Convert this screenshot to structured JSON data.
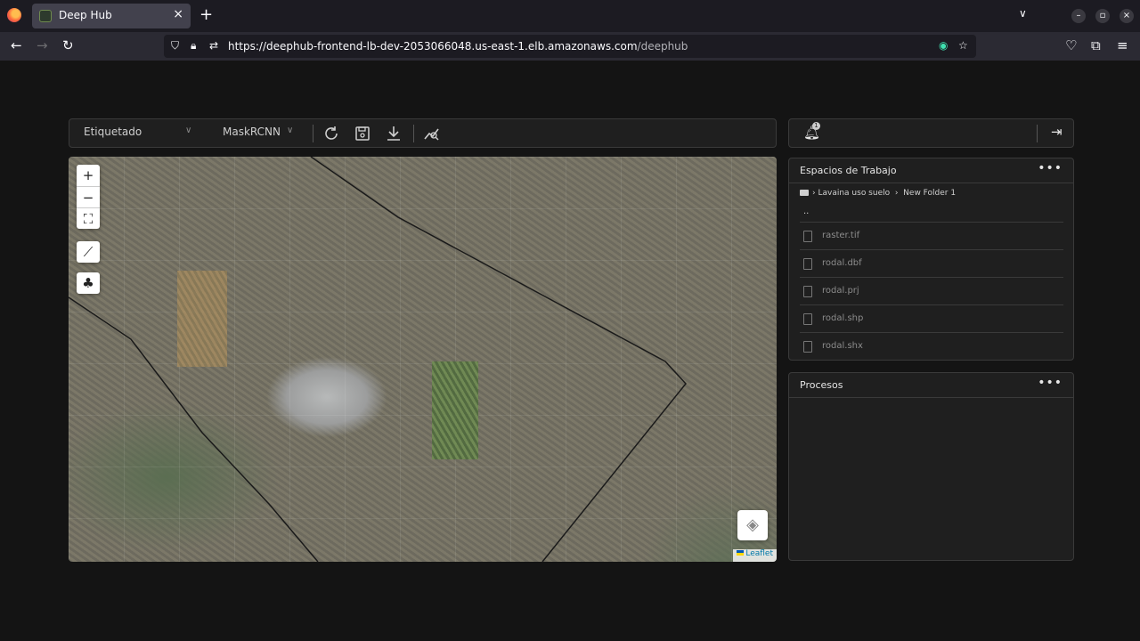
{
  "browser": {
    "tab_title": "Deep Hub",
    "tab_close": "×",
    "new_tab": "+",
    "url_host": "https://deephub-frontend-lb-dev-2053066048.us-east-1.elb.amazonaws.com",
    "url_path": "/deephub"
  },
  "toolbar": {
    "mode_select": "Etiquetado",
    "model_select": "MaskRCNN"
  },
  "map": {
    "zoom_in": "+",
    "zoom_out": "−",
    "attribution": "Leaflet"
  },
  "notifications": {
    "badge": "1"
  },
  "workspaces": {
    "title": "Espacios de Trabajo",
    "more": "•••",
    "breadcrumb_1": "Lavaina uso suelo",
    "breadcrumb_2": "New Folder 1",
    "updir": "..",
    "files": [
      "raster.tif",
      "rodal.dbf",
      "rodal.prj",
      "rodal.shp",
      "rodal.shx"
    ]
  },
  "processes": {
    "title": "Procesos",
    "more": "•••"
  }
}
